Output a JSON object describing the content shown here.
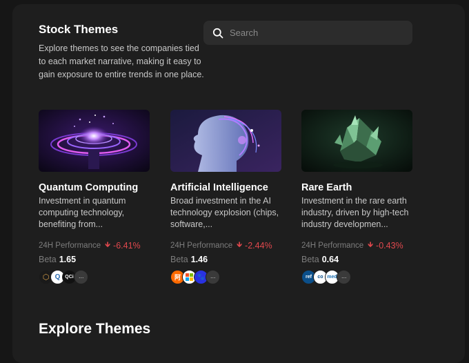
{
  "header": {
    "title": "Stock Themes",
    "description": "Explore themes to see the companies tied to each market narrative, making it easy to gain exposure to entire trends in one place."
  },
  "search": {
    "placeholder": "Search",
    "value": ""
  },
  "cards": [
    {
      "title": "Quantum Computing",
      "description": "Investment in quantum computing technology, benefiting from...",
      "perf_label": "24H Performance",
      "perf_arrow": "🡻",
      "perf_value": "-6.41%",
      "beta_label": "Beta",
      "beta_value": "1.65",
      "logos": [
        {
          "name": "hexagon-logo",
          "text": "⬡",
          "bg": "#1a1a1a",
          "fg": "#d7a04a"
        },
        {
          "name": "q-logo",
          "text": "Q",
          "bg": "#ffffff",
          "fg": "#2b6cb0"
        },
        {
          "name": "qci-logo",
          "text": "QCi",
          "bg": "#111111",
          "fg": "#ffffff"
        }
      ],
      "more": "···",
      "colors": {
        "accent": "#e0484d"
      }
    },
    {
      "title": "Artificial Intelligence",
      "description": "Broad investment in the AI technology explosion (chips, software,...",
      "perf_label": "24H Performance",
      "perf_arrow": "🡻",
      "perf_value": "-2.44%",
      "beta_label": "Beta",
      "beta_value": "1.46",
      "logos": [
        {
          "name": "alibaba-logo",
          "text": "阿",
          "bg": "#ff6a00",
          "fg": "#ffffff"
        },
        {
          "name": "microsoft-logo",
          "text": "",
          "bg": "#ffffff",
          "fg": "#000000"
        },
        {
          "name": "baidu-logo",
          "text": "🐾",
          "bg": "#2932e1",
          "fg": "#ffffff"
        }
      ],
      "more": "···",
      "colors": {
        "accent": "#e0484d"
      }
    },
    {
      "title": "Rare Earth",
      "description": "Investment in the rare earth industry, driven by high-tech industry developmen...",
      "perf_label": "24H Performance",
      "perf_arrow": "🡻",
      "perf_value": "-0.43%",
      "beta_label": "Beta",
      "beta_value": "0.64",
      "logos": [
        {
          "name": "ref-logo",
          "text": "ref",
          "bg": "#0b4f8a",
          "fg": "#ffffff"
        },
        {
          "name": "company-logo",
          "text": "co",
          "bg": "#ffffff",
          "fg": "#0b4f8a"
        },
        {
          "name": "med-logo",
          "text": "med",
          "bg": "#ffffff",
          "fg": "#1b6fb0"
        }
      ],
      "more": "···",
      "colors": {
        "accent": "#e0484d"
      }
    }
  ],
  "explore": {
    "title": "Explore Themes"
  }
}
